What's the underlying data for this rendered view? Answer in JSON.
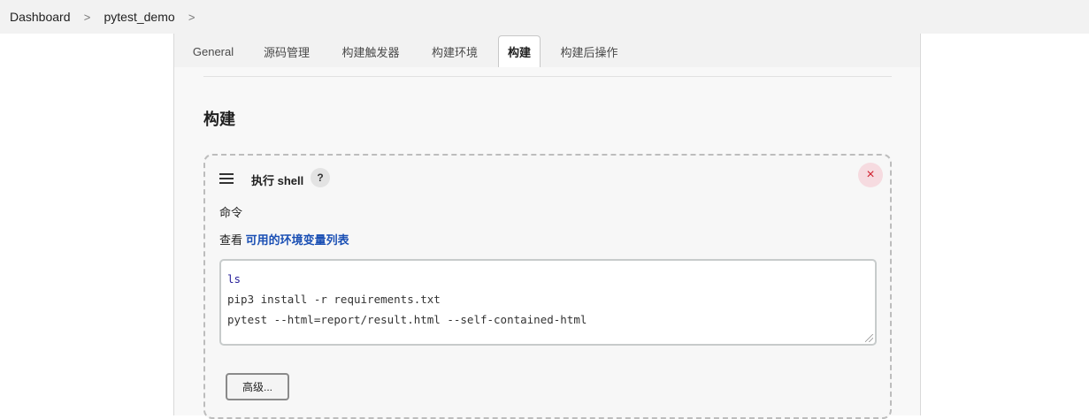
{
  "breadcrumb": {
    "items": [
      "Dashboard",
      "pytest_demo"
    ],
    "separator": ">"
  },
  "tabs": [
    {
      "label": "General",
      "active": false
    },
    {
      "label": "源码管理",
      "active": false
    },
    {
      "label": "构建触发器",
      "active": false
    },
    {
      "label": "构建环境",
      "active": false
    },
    {
      "label": "构建",
      "active": true
    },
    {
      "label": "构建后操作",
      "active": false
    }
  ],
  "section": {
    "title": "构建"
  },
  "step": {
    "title": "执行 shell",
    "help_label": "?",
    "close_label": "×",
    "command_label": "命令",
    "env_prefix": "查看",
    "env_link": "可用的环境变量列表",
    "command_lines": [
      "ls",
      "pip3 install -r requirements.txt",
      "pytest --html=report/result.html --self-contained-html"
    ],
    "advanced_label": "高级..."
  },
  "colors": {
    "link": "#1a4fb4",
    "close_bg": "#f6dbe0",
    "close_fg": "#d0202e",
    "keyword": "#28209a"
  }
}
